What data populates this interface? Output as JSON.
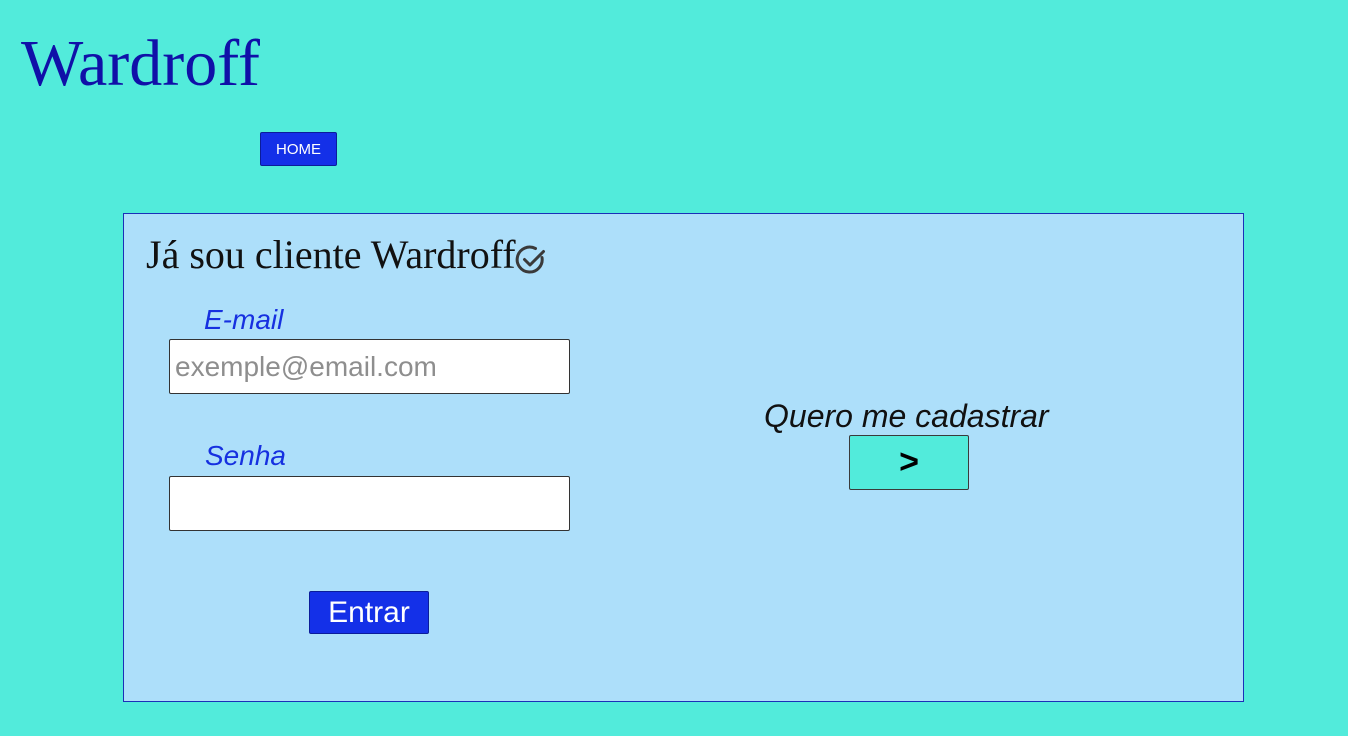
{
  "header": {
    "brand": "Wardroff",
    "nav": {
      "home_label": "HOME"
    }
  },
  "login": {
    "title": "Já sou cliente Wardroff",
    "title_icon": "check-circle-icon",
    "email": {
      "label": "E-mail",
      "placeholder": "exemple@email.com",
      "value": ""
    },
    "password": {
      "label": "Senha",
      "placeholder": "",
      "value": ""
    },
    "submit_label": "Entrar"
  },
  "register": {
    "text": "Quero me cadastrar",
    "button_label": ">"
  },
  "colors": {
    "page_background": "#52EBDB",
    "panel_background": "#ADDFFA",
    "brand": "#1010A8",
    "accent_button": "#1430E8",
    "label": "#1630E0"
  }
}
